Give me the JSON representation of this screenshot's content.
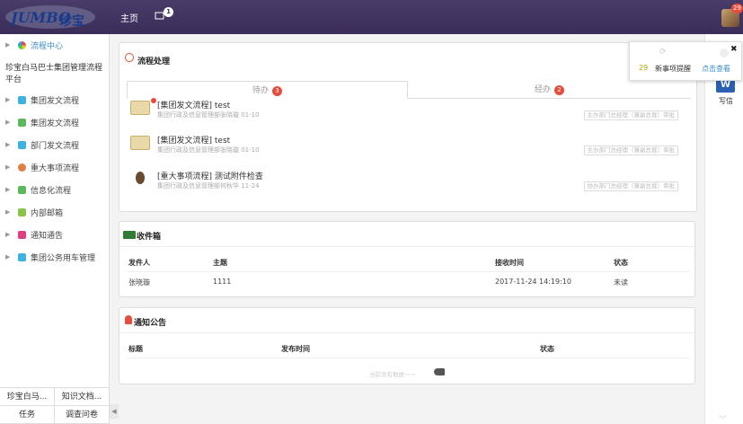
{
  "header": {
    "logo_text": "JUMBO 珍宝",
    "nav_home": "主页",
    "nav_badge": "1",
    "avatar_badge": "29"
  },
  "sidebar": {
    "top_item": "流程中心",
    "org_name": "珍宝白马巴士集团管理流程平台",
    "items": [
      {
        "label": "集团发文流程",
        "color": "#3cb3e0"
      },
      {
        "label": "集团发文流程",
        "color": "#5cb85c"
      },
      {
        "label": "部门发文流程",
        "color": "#3cb3e0"
      },
      {
        "label": "重大事项流程",
        "color": "#e08040"
      },
      {
        "label": "信息化流程",
        "color": "#5cb85c"
      },
      {
        "label": "内部邮箱",
        "color": "#8bc34a"
      },
      {
        "label": "通知通告",
        "color": "#e04080"
      },
      {
        "label": "集团公务用车管理",
        "color": "#3cb3e0"
      }
    ],
    "bottom": [
      [
        "珍宝白马...",
        "知识文档..."
      ],
      [
        "任务",
        "调查问卷"
      ]
    ]
  },
  "flow_panel": {
    "title": "流程处理",
    "tab_pending": "待办",
    "tab_pending_count": "3",
    "tab_done": "经办",
    "tab_done_count": "2",
    "items": [
      {
        "title": "[集团发文流程] test",
        "sub": "集团行政及信息管理部张晓璇 01-10",
        "tag": "主办部门总经理（兼副总裁）审批"
      },
      {
        "title": "[集团发文流程] test",
        "sub": "集团行政及信息管理部张晓璇 01-10",
        "tag": "主办部门总经理（兼副总裁）审批"
      },
      {
        "title": "[重大事项流程] 测试附件检查",
        "sub": "集团行政及信息管理部何秋华 11-24",
        "tag": "协办部门总经理（兼副总裁）审批"
      }
    ]
  },
  "inbox": {
    "title": "收件箱",
    "headers": [
      "发件人",
      "主题",
      "接收时间",
      "状态"
    ],
    "rows": [
      [
        "张晓璇",
        "1111",
        "2017-11-24 14:19:10",
        "未读"
      ]
    ]
  },
  "notice": {
    "title": "通知公告",
    "headers": [
      "标题",
      "发布时间",
      "状态"
    ],
    "empty": "当前没有数据～～"
  },
  "notify": {
    "count": "29",
    "text": "新事项提醒",
    "link": "点击查看"
  },
  "right_rail": {
    "word_label": "写信",
    "word_icon": "W"
  }
}
